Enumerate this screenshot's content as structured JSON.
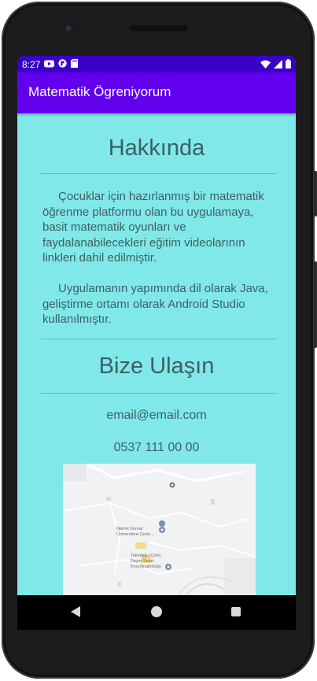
{
  "status_bar": {
    "time": "8:27",
    "left_icons": [
      "youtube-icon",
      "app-notification-icon",
      "sd-card-icon"
    ],
    "right_icons": [
      "wifi-icon",
      "signal-icon",
      "battery-icon"
    ]
  },
  "app_bar": {
    "title": "Matematik Ögreniyorum"
  },
  "about": {
    "heading": "Hakkında",
    "paragraph_1": "Çocuklar için hazırlanmış bir matematik öğrenme platformu olan bu uygulamaya, basit matematik oyunları ve faydalanabilecekleri eğitim videolarının linkleri dahil edilmiştir.",
    "paragraph_2": "Uygulamanın yapımında dil olarak Java, geliştirme ortamı olarak Android Studio kullanılmıştır."
  },
  "contact": {
    "heading": "Bize Ulaşın",
    "email": "email@email.com",
    "phone": "0537 111 00 00"
  },
  "map": {
    "places": [
      "Namık Kemal Üniversitesi Çorlu...",
      "Tekirdağ / Çorlu Deym Sınav Koordinatörlüğü"
    ]
  },
  "colors": {
    "status_bar": "#3a00c7",
    "app_bar": "#6200ee",
    "background": "#80e8e8",
    "text": "#3d5f64"
  }
}
